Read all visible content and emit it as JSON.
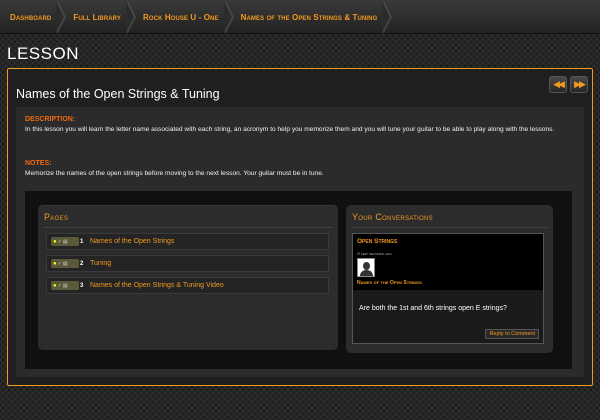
{
  "breadcrumb": [
    "Dashboard",
    "Full Library",
    "Rock House U - One",
    "Names of the Open Strings & Tuning"
  ],
  "page_heading": "LESSON",
  "nav": {
    "prev_icon": "double-left-arrow",
    "next_icon": "double-right-arrow"
  },
  "lesson": {
    "title": "Names of the Open Strings & Tuning",
    "description_label": "DESCRIPTION:",
    "description": "In this lesson you will learn the letter name associated with each string, an acronym to help you memorize them and you will tune your guitar to be able to play along with the lessons.",
    "notes_label": "NOTES:",
    "notes": "Memorize the names of the open strings before moving to the next lesson. Your guitar must be in tune."
  },
  "pages": {
    "title": "Pages",
    "items": [
      {
        "num": "1",
        "label": "Names of the Open Strings"
      },
      {
        "num": "2",
        "label": "Tuning"
      },
      {
        "num": "3",
        "label": "Names of the Open Strings & Tuning Video"
      }
    ]
  },
  "conversations": {
    "title": "Your Conversations",
    "topic": "Open Strings",
    "time": "A few seconds ago",
    "lesson": "Names of the Open Strings",
    "message": "Are both the 1st and 6th strings open E strings?",
    "reply_label": "Reply to Comment"
  },
  "colors": {
    "accent": "#f39a1e",
    "label": "#f06a10"
  }
}
